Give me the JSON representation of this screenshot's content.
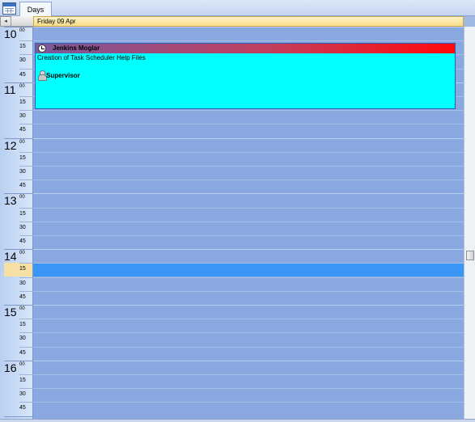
{
  "tabs": [
    {
      "label": "Days",
      "active": true
    }
  ],
  "icons": {
    "calendar": "calendar-icon",
    "nav_left": "chevron-left-icon",
    "appointment": "clock-icon",
    "resource": "person-icon"
  },
  "nav": {
    "left_arrow": "◂"
  },
  "day_header": {
    "label": "Friday  09 Apr"
  },
  "hours": [
    {
      "hour": "10",
      "minutes": "00",
      "quarters": [
        "15",
        "30",
        "45"
      ]
    },
    {
      "hour": "11",
      "minutes": "00",
      "quarters": [
        "15",
        "30",
        "45"
      ]
    },
    {
      "hour": "12",
      "minutes": "00",
      "quarters": [
        "15",
        "30",
        "45"
      ]
    },
    {
      "hour": "13",
      "minutes": "00",
      "quarters": [
        "15",
        "30",
        "45"
      ]
    },
    {
      "hour": "14",
      "minutes": "00",
      "quarters": [
        "15",
        "30",
        "45"
      ]
    },
    {
      "hour": "15",
      "minutes": "00",
      "quarters": [
        "15",
        "30",
        "45"
      ]
    },
    {
      "hour": "16",
      "minutes": "00",
      "quarters": [
        "15",
        "30",
        "45"
      ]
    }
  ],
  "selected_slot": {
    "hour": "14",
    "minutes": "15"
  },
  "appointment": {
    "name": "Jenkins Moglar",
    "description": "Creation of Task Scheduler Help Files",
    "role": "Supervisor",
    "colors": {
      "background": "#00ffff",
      "bar_start": "#7a5a9c",
      "bar_end": "#ff0a0a"
    }
  },
  "colors": {
    "selected_row": "#3a96f5",
    "day_background": "#88a8df",
    "header": "#f7dc8a"
  }
}
